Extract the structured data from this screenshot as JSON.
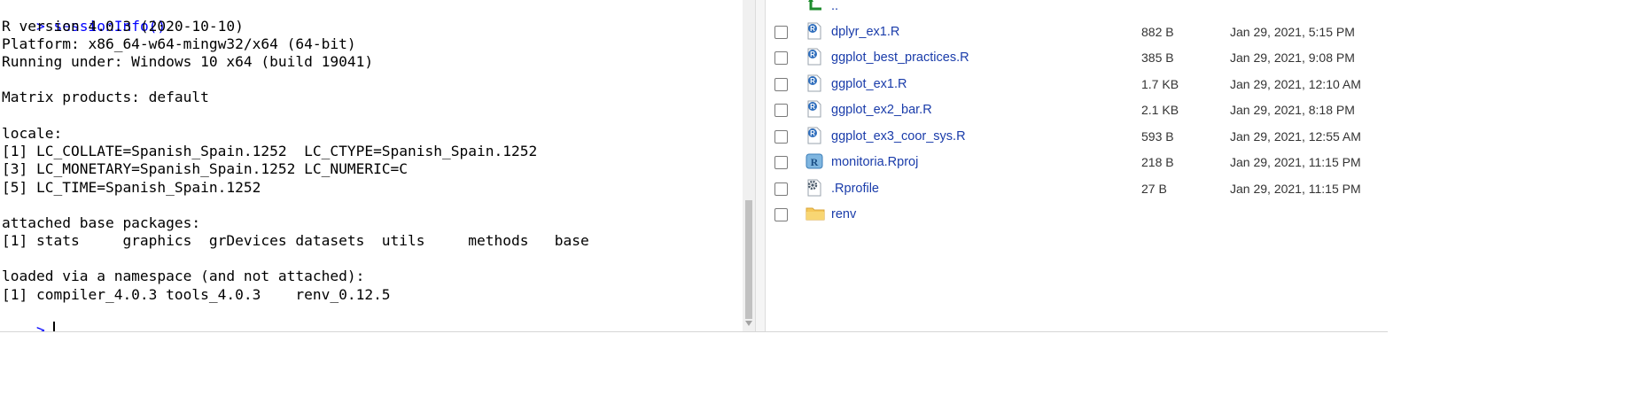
{
  "console": {
    "prompt": ">",
    "command": "sessionInfo()",
    "lines": [
      "R version 4.0.3 (2020-10-10)",
      "Platform: x86_64-w64-mingw32/x64 (64-bit)",
      "Running under: Windows 10 x64 (build 19041)",
      "",
      "Matrix products: default",
      "",
      "locale:",
      "[1] LC_COLLATE=Spanish_Spain.1252  LC_CTYPE=Spanish_Spain.1252",
      "[3] LC_MONETARY=Spanish_Spain.1252 LC_NUMERIC=C",
      "[5] LC_TIME=Spanish_Spain.1252",
      "",
      "attached base packages:",
      "[1] stats     graphics  grDevices datasets  utils     methods   base",
      "",
      "loaded via a namespace (and not attached):",
      "[1] compiler_4.0.3 tools_4.0.3    renv_0.12.5"
    ]
  },
  "files": {
    "parent": {
      "name": "..",
      "icon": "up-arrow-icon"
    },
    "items": [
      {
        "name": "dplyr_ex1.R",
        "size": "882 B",
        "modified": "Jan 29, 2021, 5:15 PM",
        "icon": "r-script-icon"
      },
      {
        "name": "ggplot_best_practices.R",
        "size": "385 B",
        "modified": "Jan 29, 2021, 9:08 PM",
        "icon": "r-script-icon"
      },
      {
        "name": "ggplot_ex1.R",
        "size": "1.7 KB",
        "modified": "Jan 29, 2021, 12:10 AM",
        "icon": "r-script-icon"
      },
      {
        "name": "ggplot_ex2_bar.R",
        "size": "2.1 KB",
        "modified": "Jan 29, 2021, 8:18 PM",
        "icon": "r-script-icon"
      },
      {
        "name": "ggplot_ex3_coor_sys.R",
        "size": "593 B",
        "modified": "Jan 29, 2021, 12:55 AM",
        "icon": "r-script-icon"
      },
      {
        "name": "monitoria.Rproj",
        "size": "218 B",
        "modified": "Jan 29, 2021, 11:15 PM",
        "icon": "r-project-icon"
      },
      {
        "name": ".Rprofile",
        "size": "27 B",
        "modified": "Jan 29, 2021, 11:15 PM",
        "icon": "gear-file-icon"
      },
      {
        "name": "renv",
        "size": "",
        "modified": "",
        "icon": "folder-icon"
      }
    ]
  },
  "colors": {
    "prompt": "#0000ff",
    "link": "#1a3caa"
  }
}
